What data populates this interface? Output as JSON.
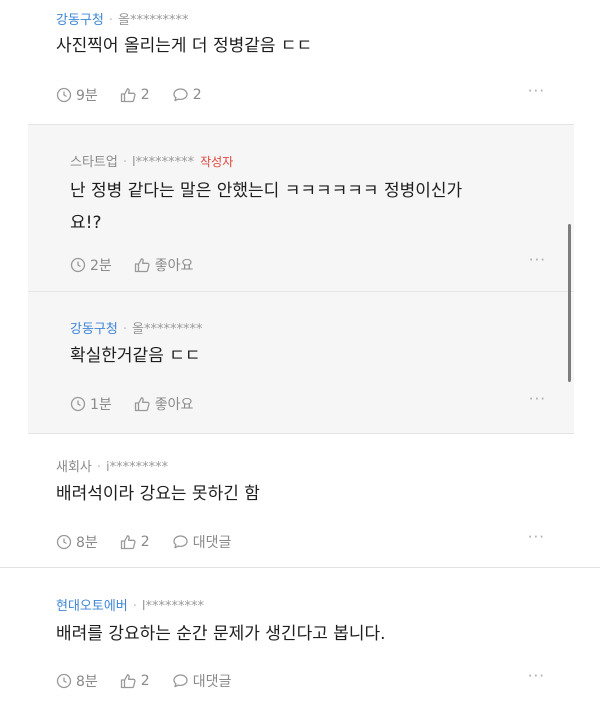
{
  "comments": [
    {
      "nick": "강동구청",
      "user_id": "올*********",
      "text": "사진찍어 올리는게 더 정병같음 ㄷㄷ",
      "time": "9분",
      "likes": "2",
      "replies": "2"
    },
    {
      "nick": "새회사",
      "user_id": "i*********",
      "text": "배려석이라 강요는 못하긴 함",
      "time": "8분",
      "likes": "2",
      "reply_label": "대댓글"
    },
    {
      "nick": "현대오토에버",
      "user_id": "l*********",
      "text": "배려를 강요하는 순간 문제가 생긴다고 봅니다.",
      "time": "8분",
      "likes": "2",
      "reply_label": "대댓글"
    }
  ],
  "replies": [
    {
      "nick": "스타트업",
      "user_id": "l*********",
      "writer_badge": "작성자",
      "text_line1": "난 정병 같다는 말은 안했는디 ㅋㅋㅋㅋㅋㅋ 정병이신가",
      "text_line2": "요!?",
      "time": "2분",
      "like_label": "좋아요"
    },
    {
      "nick": "강동구청",
      "user_id": "올*********",
      "text": "확실한거같음 ㄷㄷ",
      "time": "1분",
      "like_label": "좋아요"
    }
  ],
  "more_label": "···",
  "separator": "·",
  "colors": {
    "nick_blue": "#3f86d6",
    "writer_red": "#e0453c",
    "reply_bg": "#f6f6f6"
  }
}
